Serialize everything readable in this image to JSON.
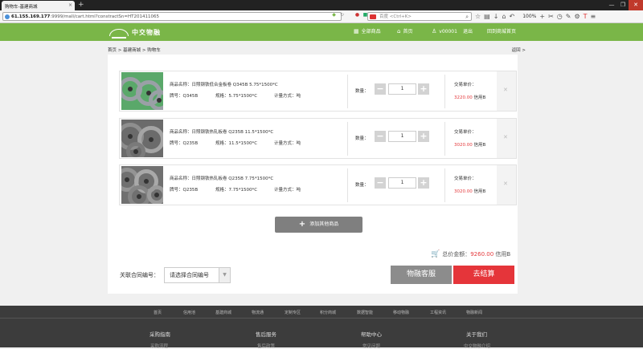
{
  "browser": {
    "tab_title": "购物车-基建商城",
    "tab_close": "×",
    "new_tab": "+",
    "url_host": "61.155.169.177",
    "url_rest": ":9999/mall/cart.html?constractSn=HT201411065",
    "search_placeholder": "百度 <Ctrl+K>",
    "zoom": "100%",
    "window_controls": [
      "—",
      "❐",
      "✕"
    ]
  },
  "header": {
    "logo_text": "中交物融",
    "nav": [
      {
        "label": "全部商品",
        "icon": "grid-icon"
      },
      {
        "label": "首页",
        "icon": "home-icon"
      },
      {
        "label": "v00001",
        "icon": "user-icon"
      },
      {
        "label": "退出",
        "icon": ""
      },
      {
        "label": "回到商城首页",
        "icon": ""
      }
    ]
  },
  "breadcrumb": {
    "path": "首页 > 基建商城 > 购物车",
    "back": "返回 >"
  },
  "cart": {
    "labels": {
      "name_prefix": "商品名称：",
      "brand": "牌号：",
      "spec": "规格：",
      "measure": "计量方式：",
      "qty": "数量：",
      "unit_price": "交易单价：",
      "minus": "−",
      "plus": "+",
      "delete": "✕"
    },
    "items": [
      {
        "name": "日照钢铁低合金板卷 Q345B 5.75*1500*C",
        "brand": "Q345B",
        "spec": "5.75*1500*C",
        "measure": "吨",
        "qty": "1",
        "price": "3220.00",
        "currency": "信用B"
      },
      {
        "name": "日照钢铁热轧板卷 Q235B 11.5*1500*C",
        "brand": "Q235B",
        "spec": "11.5*1500*C",
        "measure": "吨",
        "qty": "1",
        "price": "3020.00",
        "currency": "信用B"
      },
      {
        "name": "日照钢铁热轧板卷 Q235B 7.75*1500*C",
        "brand": "Q235B",
        "spec": "7.75*1500*C",
        "measure": "吨",
        "qty": "1",
        "price": "3020.00",
        "currency": "信用B"
      }
    ],
    "add_button": "添加其他商品",
    "total_label": "总价金额：",
    "total_amount": "9260.00",
    "total_currency": "信用B",
    "contract_label": "关联合同编号：",
    "contract_placeholder": "请选择合同编号",
    "service_button": "物融客服",
    "checkout_button": "去结算"
  },
  "footer": {
    "links": [
      "首页",
      "信用池",
      "基建商城",
      "物流通",
      "定制专区",
      "积分商城",
      "数据智能",
      "移动物融",
      "工程资讯",
      "物融新闻"
    ],
    "columns": [
      "采购指南",
      "售后服务",
      "帮助中心",
      "关于我们"
    ],
    "subs": [
      "采购流程",
      "售后政策",
      "常见问题",
      "中交物融介绍"
    ]
  },
  "colors": {
    "brand_green": "#7ab648",
    "price_red": "#e4393c",
    "checkout_red": "#e5353a",
    "service_gray": "#8c8c8c"
  }
}
